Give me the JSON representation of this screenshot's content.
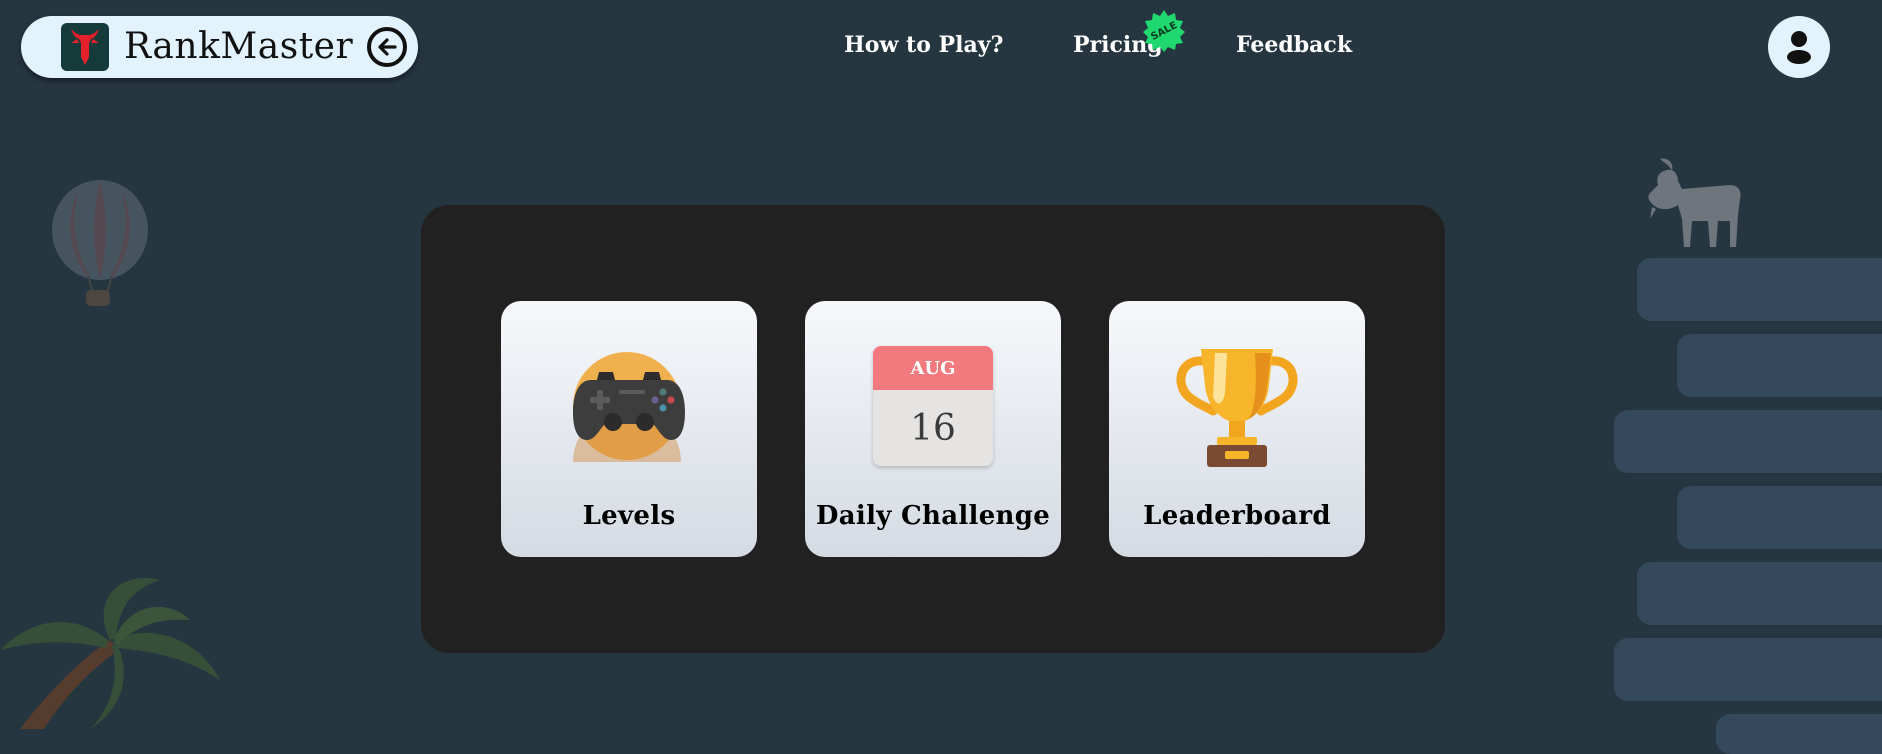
{
  "app": {
    "name": "RankMaster"
  },
  "nav": {
    "links": [
      {
        "label": "How to Play?"
      },
      {
        "label": "Pricing"
      },
      {
        "label": "Feedback"
      }
    ],
    "sale_badge": "SALE"
  },
  "menu": {
    "cards": [
      {
        "label": "Levels",
        "icon": "gamepad-icon"
      },
      {
        "label": "Daily Challenge",
        "icon": "calendar-icon",
        "calendar": {
          "month": "AUG",
          "day": "16"
        }
      },
      {
        "label": "Leaderboard",
        "icon": "trophy-icon"
      }
    ]
  },
  "colors": {
    "background": "#263640",
    "panel": "#212121",
    "header_pill": "#e3f3fd",
    "sale_badge": "#1fd86f",
    "calendar_header": "#f27a7f",
    "brick": "#34495b"
  }
}
